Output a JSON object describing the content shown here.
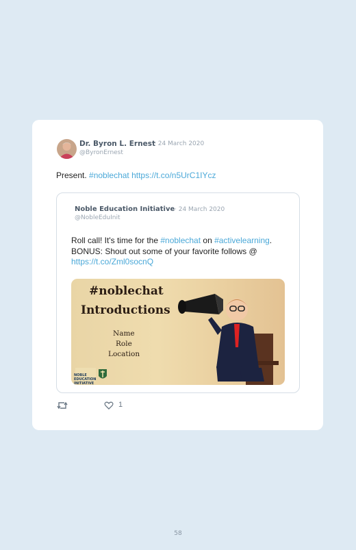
{
  "tweet": {
    "author_name": "Dr. Byron L. Ernest",
    "date": "· 24 March 2020",
    "handle": "@ByronErnest",
    "text_plain": "Present. ",
    "hashtag": "#noblechat",
    "link": "https://t.co/n5UrC1IYcz",
    "likes": "1"
  },
  "quote": {
    "author_name": "Noble Education Initiative",
    "date": "· 24 March 2020",
    "handle": "@NobleEduInit",
    "text_1": "Roll call! It's time for the ",
    "hashtag_1": "#noblechat",
    "text_2": " on ",
    "hashtag_2": "#activelearning",
    "text_3": ". BONUS: Shout out some of your favorite follows @ ",
    "link": "https://t.co/Zml0socnQ",
    "image": {
      "title_line1": "#noblechat",
      "title_line2": "Introductions",
      "items": [
        "Name",
        "Role",
        "Location"
      ],
      "logo_text": "NOBLE EDUCATION INITIATIVE"
    }
  },
  "icons": {
    "retweet": "retweet-icon",
    "like": "heart-icon"
  },
  "colors": {
    "link": "#4aa8d8",
    "background": "#deeaf3",
    "card": "#ffffff"
  },
  "page_number": "58"
}
